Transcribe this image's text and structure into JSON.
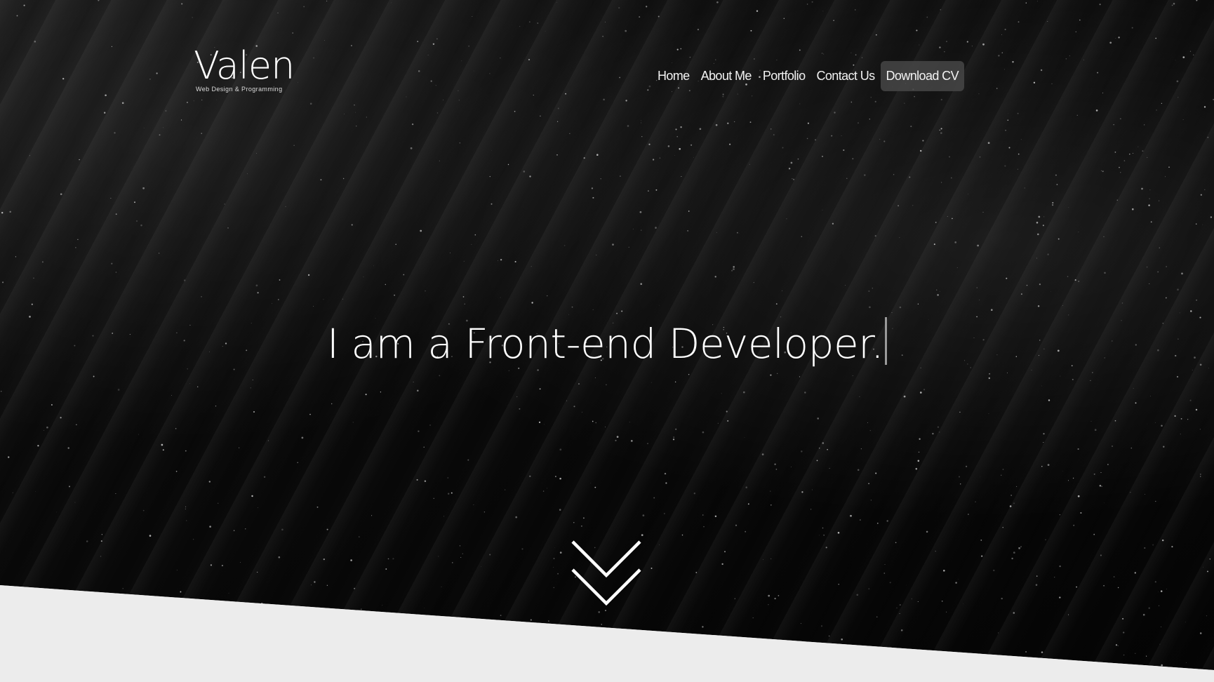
{
  "logo": {
    "title": "Valen",
    "subtitle": "Web Design & Programming"
  },
  "nav": {
    "items": [
      {
        "label": "Home"
      },
      {
        "label": "About Me"
      },
      {
        "label": "Portfolio"
      },
      {
        "label": "Contact Us"
      }
    ],
    "cta_label": "Download CV"
  },
  "hero": {
    "headline": "I am a Front-end Developer.",
    "scroll_icon": "double-chevron-down-icon"
  },
  "colors": {
    "background_dark": "#0b0b0b",
    "text": "#ffffff",
    "cta_background": "#464646",
    "bottom_band": "#ececec",
    "cursor": "#9a9a9a"
  }
}
